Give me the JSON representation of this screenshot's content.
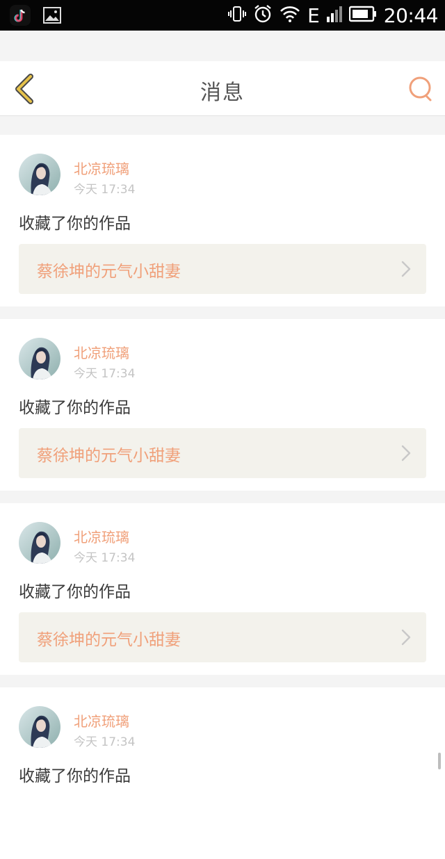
{
  "status_bar": {
    "time": "20:44",
    "network": "E",
    "icons": [
      "tiktok-icon",
      "gallery-icon",
      "vibrate-icon",
      "alarm-icon",
      "wifi-icon",
      "signal-icon",
      "battery-icon"
    ]
  },
  "header": {
    "title": "消息",
    "back_icon": "chevron-left-icon",
    "search_icon": "search-icon",
    "accent_color": "#f0a07a",
    "back_color": "#e6c24a"
  },
  "messages": [
    {
      "user": "北凉琉璃",
      "time": "今天 17:34",
      "action": "收藏了你的作品",
      "work_title": "蔡徐坤的元气小甜妻"
    },
    {
      "user": "北凉琉璃",
      "time": "今天 17:34",
      "action": "收藏了你的作品",
      "work_title": "蔡徐坤的元气小甜妻"
    },
    {
      "user": "北凉琉璃",
      "time": "今天 17:34",
      "action": "收藏了你的作品",
      "work_title": "蔡徐坤的元气小甜妻"
    },
    {
      "user": "北凉琉璃",
      "time": "今天 17:34",
      "action": "收藏了你的作品",
      "work_title": ""
    }
  ]
}
